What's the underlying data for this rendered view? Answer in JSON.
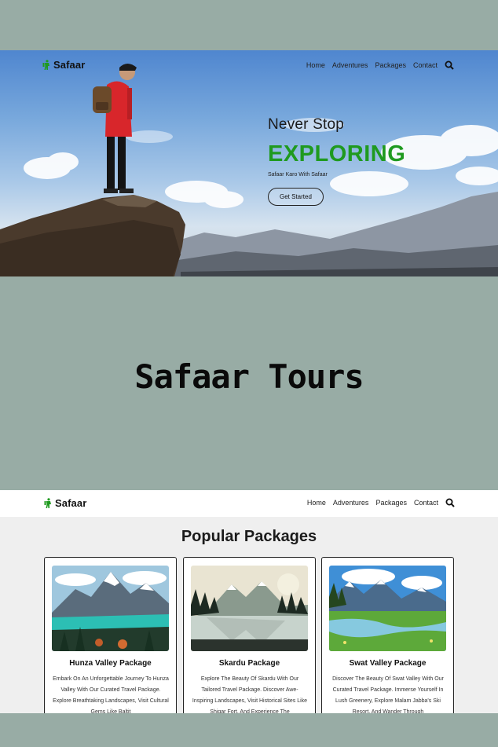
{
  "hero_page": {
    "brand": "Safaar",
    "nav": [
      "Home",
      "Adventures",
      "Packages",
      "Contact"
    ],
    "subheading": "Never Stop",
    "heading": "EXPLORING",
    "tagline": "Safaar Karo With Safaar",
    "cta": "Get Started"
  },
  "title": "Safaar Tours",
  "packages_page": {
    "brand": "Safaar",
    "nav": [
      "Home",
      "Adventures",
      "Packages",
      "Contact"
    ],
    "section_title": "Popular Packages",
    "cards": [
      {
        "name": "Hunza Valley Package",
        "description": "Embark On An Unforgettable Journey To Hunza Valley With Our Curated Travel Package. Explore Breathtaking Landscapes, Visit Cultural Gems Like Baltit"
      },
      {
        "name": "Skardu Package",
        "description": "Explore The Beauty Of Skardu With Our Tailored Travel Package. Discover Awe-Inspiring Landscapes, Visit Historical Sites Like Shigar Fort, And Experience The"
      },
      {
        "name": "Swat Valley Package",
        "description": "Discover The Beauty Of Swat Valley With Our Curated Travel Package. Immerse Yourself In Lush Greenery, Explore Malam Jabba's Ski Resort, And Wander Through"
      }
    ]
  },
  "colors": {
    "background": "#98aca5",
    "accent_green": "#1f9a1f",
    "text_dark": "#111111"
  }
}
